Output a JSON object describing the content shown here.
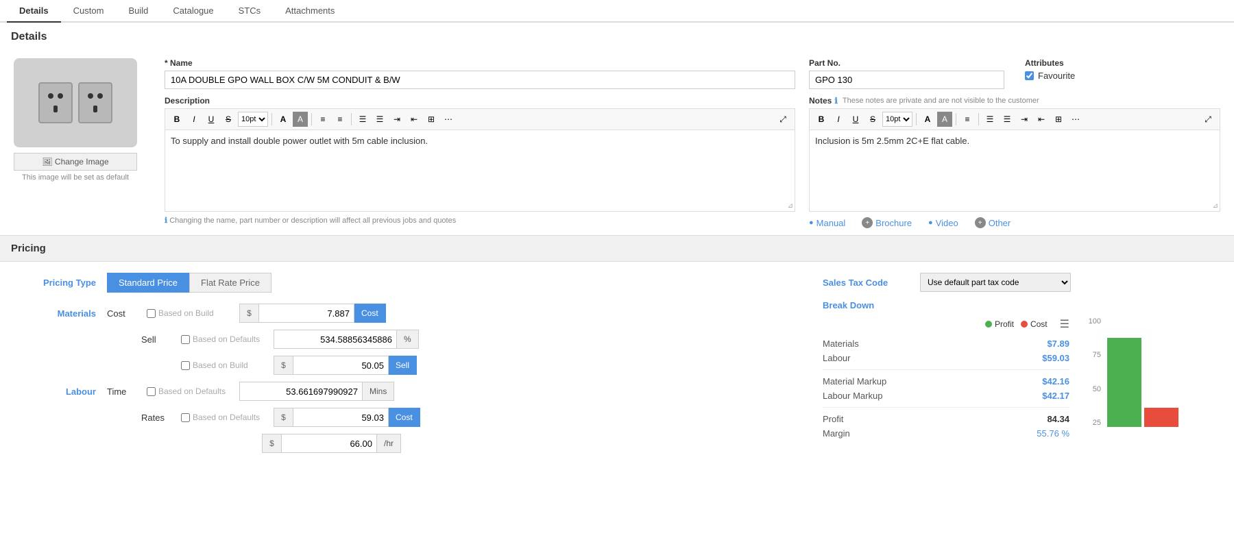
{
  "tabs": [
    {
      "label": "Details",
      "active": true
    },
    {
      "label": "Custom",
      "active": false
    },
    {
      "label": "Build",
      "active": false
    },
    {
      "label": "Catalogue",
      "active": false
    },
    {
      "label": "STCs",
      "active": false
    },
    {
      "label": "Attachments",
      "active": false
    }
  ],
  "details": {
    "section_title": "Details",
    "name_label": "* Name",
    "name_value": "10A DOUBLE GPO WALL BOX C/W 5M CONDUIT & B/W",
    "description_label": "Description",
    "description_text": "To supply and install double power outlet with 5m cable inclusion.",
    "description_warning": "Changing the name, part number or description will affect all previous jobs and quotes",
    "part_no_label": "Part No.",
    "part_no_value": "GPO 130",
    "attributes_label": "Attributes",
    "favourite_label": "Favourite",
    "favourite_checked": true,
    "notes_label": "Notes",
    "notes_hint": "These notes are private and are not visible to the customer",
    "notes_text": "Inclusion is 5m 2.5mm 2C+E flat cable.",
    "change_image_label": "Change Image",
    "image_default_note": "This image will be set as default",
    "links": [
      {
        "label": "Manual",
        "type": "blue",
        "has_add": false
      },
      {
        "label": "Brochure",
        "type": "add_gray"
      },
      {
        "label": "Video",
        "type": "blue"
      },
      {
        "label": "Other",
        "type": "add_gray"
      }
    ],
    "toolbar_font_size": "10pt"
  },
  "pricing": {
    "section_title": "Pricing",
    "pricing_type_label": "Pricing Type",
    "standard_price_label": "Standard Price",
    "flat_rate_price_label": "Flat Rate Price",
    "materials_label": "Materials",
    "cost_label": "Cost",
    "based_on_build": "Based on Build",
    "based_on_defaults": "Based on Defaults",
    "cost_value": "7.887",
    "cost_btn": "Cost",
    "sell_label": "Sell",
    "sell_value": "534.58856345886",
    "sell_suffix": "%",
    "sell_build_value": "50.05",
    "sell_btn": "Sell",
    "labour_label": "Labour",
    "time_label": "Time",
    "time_value": "53.661697990927",
    "time_suffix": "Mins",
    "rates_label": "Rates",
    "rates_value": "59.03",
    "rates_btn": "Cost",
    "rates_per_value": "66.00",
    "rates_per_suffix": "/hr",
    "sales_tax_label": "Sales Tax Code",
    "sales_tax_value": "Use default part tax code",
    "breakdown_label": "Break Down",
    "profit_legend": "Profit",
    "cost_legend": "Cost",
    "breakdown_items": [
      {
        "name": "Materials",
        "value": "$7.89"
      },
      {
        "name": "Labour",
        "value": "$59.03"
      },
      {
        "name": "Material Markup",
        "value": "$42.16"
      },
      {
        "name": "Labour Markup",
        "value": "$42.17"
      },
      {
        "name": "Profit",
        "value": "84.34"
      },
      {
        "name": "Margin",
        "value": "55.76 %"
      }
    ],
    "chart_labels": [
      "100",
      "75",
      "50",
      "25"
    ],
    "profit_bar_height": "120",
    "cost_bar_height": "30"
  }
}
